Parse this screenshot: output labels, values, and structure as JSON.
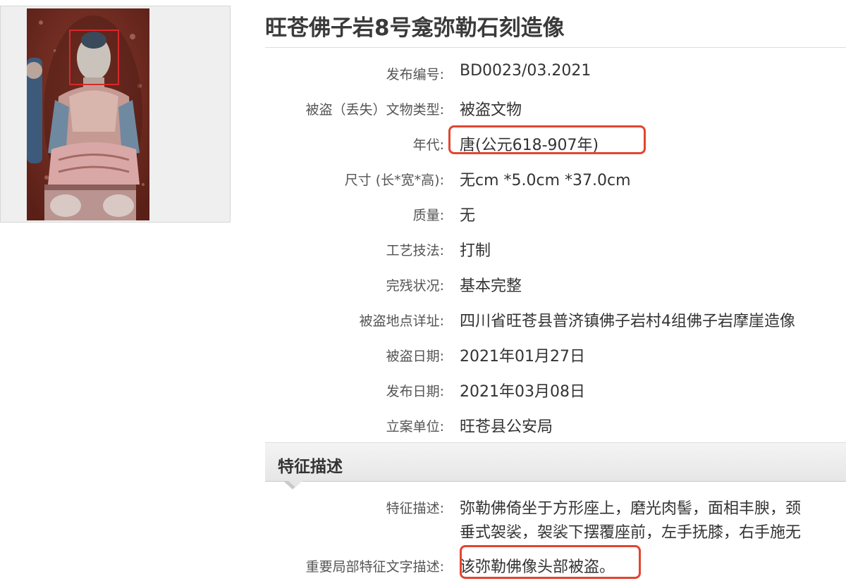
{
  "title": "旺苍佛子岩8号龛弥勒石刻造像",
  "fields": [
    {
      "label": "发布编号:",
      "value": "BD0023/03.2021"
    },
    {
      "label": "被盗（丢失）文物类型:",
      "value": "被盗文物"
    },
    {
      "label": "年代:",
      "value": "唐(公元618-907年)"
    },
    {
      "label": "尺寸 (长*宽*高):",
      "value": "无cm *5.0cm *37.0cm"
    },
    {
      "label": "质量:",
      "value": "无"
    },
    {
      "label": "工艺技法:",
      "value": "打制"
    },
    {
      "label": "完残状况:",
      "value": "基本完整"
    },
    {
      "label": "被盗地点详址:",
      "value": "四川省旺苍县普济镇佛子岩村4组佛子岩摩崖造像"
    },
    {
      "label": "被盗日期:",
      "value": "2021年01月27日"
    },
    {
      "label": "发布日期:",
      "value": "2021年03月08日"
    },
    {
      "label": "立案单位:",
      "value": "旺苍县公安局"
    }
  ],
  "section": {
    "title": "特征描述"
  },
  "description": {
    "label": "特征描述:",
    "lines": [
      "弥勒佛倚坐于方形座上，磨光肉髻，面相丰腴，颈",
      "垂式袈裟，袈裟下摆覆座前，左手抚膝，右手施无"
    ]
  },
  "key_features": {
    "label": "重要局部特征文字描述:",
    "value": "该弥勒佛像头部被盗。"
  },
  "colors": {
    "highlight": "#e2452f",
    "face_box": "#d8282b"
  }
}
